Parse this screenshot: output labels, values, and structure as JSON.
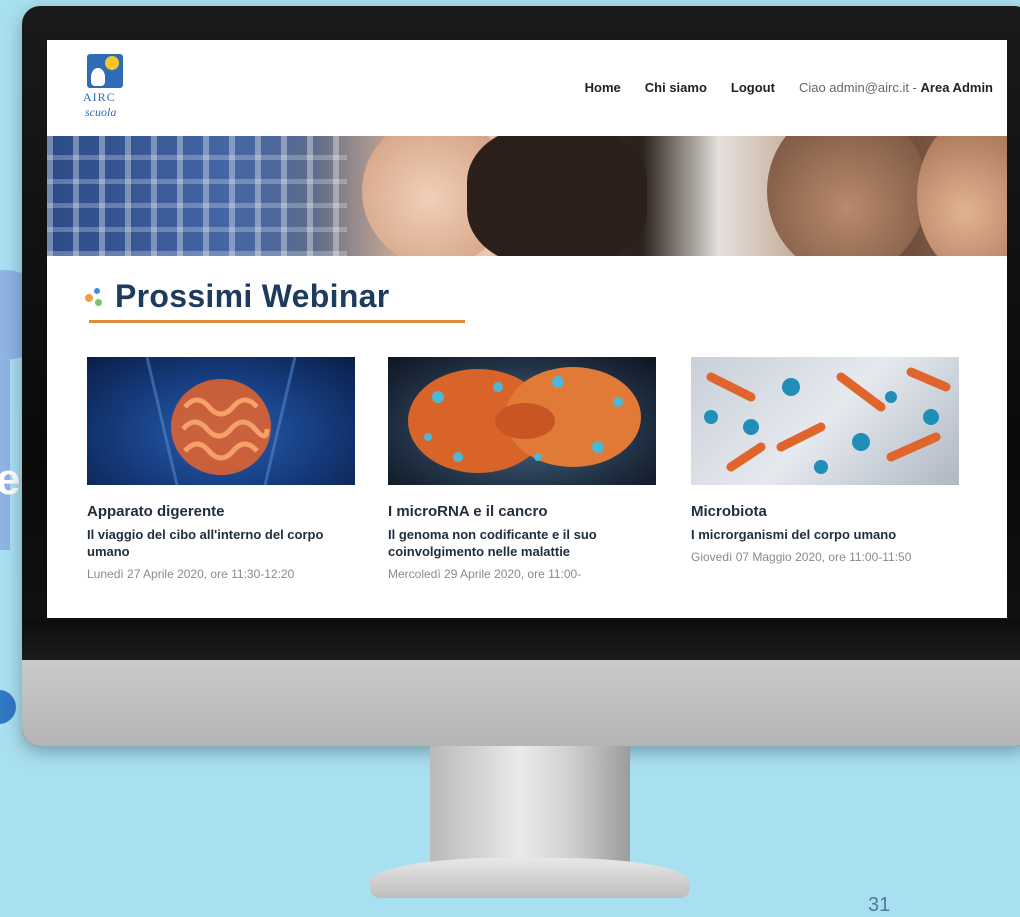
{
  "page_number": "31",
  "logo": {
    "name": "AIRC",
    "sub": "scuola"
  },
  "nav": {
    "home": "Home",
    "about": "Chi siamo",
    "logout": "Logout",
    "greeting_prefix": "Ciao admin@airc.it - ",
    "admin_area": "Area Admin"
  },
  "section": {
    "title": "Prossimi Webinar"
  },
  "webinars": [
    {
      "title": "Apparato digerente",
      "subtitle": "Il viaggio del cibo all'interno del corpo umano",
      "date": "Lunedì 27 Aprile 2020, ore 11:30-12:20"
    },
    {
      "title": "I microRNA e il cancro",
      "subtitle": "Il genoma non codificante e il suo coinvolgimento nelle malattie",
      "date": "Mercoledì 29 Aprile 2020, ore 11:00-"
    },
    {
      "title": "Microbiota",
      "subtitle": "I microrganismi del corpo umano",
      "date": "Giovedì 07 Maggio 2020, ore 11:00-11:50"
    }
  ]
}
